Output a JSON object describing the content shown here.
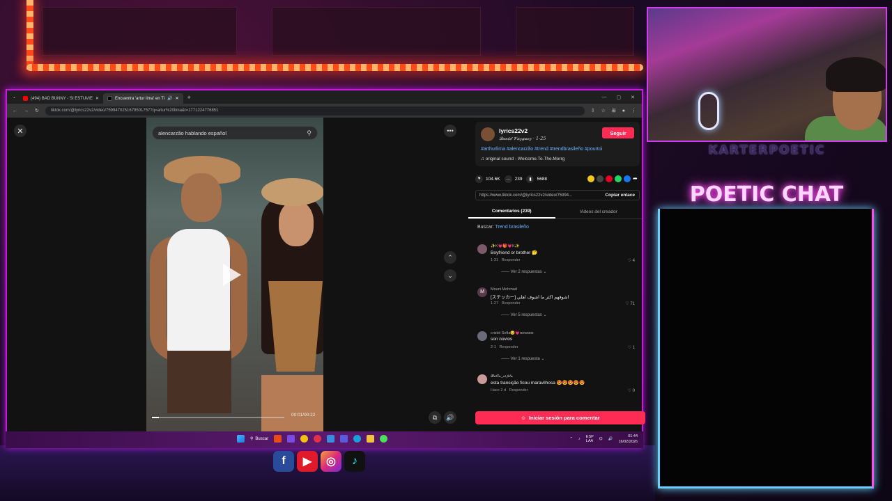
{
  "browser": {
    "tabs": [
      {
        "label": "(494) BAD BUNNY - SI ESTUVIE",
        "fav_color": "#ff0000"
      },
      {
        "label": "Encuentra 'artur lima' en Ti",
        "fav_color": "#000000"
      }
    ],
    "new_tab": "+",
    "url": "tiktok.com/@lyrics22v2/video/7599470251679501757?q=artur%20lima&t=1771224776851"
  },
  "video": {
    "search_text": "alencarzão hablando español",
    "time": "00:01/00:22",
    "progress": 0.05
  },
  "post": {
    "username": "lyrics22v2",
    "display_name": "𝓓𝓪𝓿𝓲𝓭 𝓥𝓪𝔃𝓺𝓾𝓮𝔃",
    "date": "· 1-25",
    "follow": "Seguir",
    "hashtags": "#arthurlima #alencarzão #trend #trendbrasileño #pourtoi",
    "sound": "♫  original sound - Welcome.To.The.Morrg",
    "likes": "104.6K",
    "comments": "239",
    "saves": "5688",
    "link": "https://www.tiktok.com/@lyrics22v2/video/75994...",
    "copy_link": "Copiar enlace",
    "tab_comments": "Comentarios (239)",
    "tab_videos": "Videos del creador",
    "search_prefix": "Buscar:",
    "search_term": "Trend brasileño",
    "login": "Iniciar sesión para comentar"
  },
  "comments": [
    {
      "user": "✨K💗🎁💗K✨",
      "text": "Boyfriend or brother 🤔",
      "date": "1-31",
      "reply": "Responder",
      "likes": "4",
      "replies": "Ver 2 respuestas ⌄"
    },
    {
      "user": "Mouni Mohmad",
      "text": "[ステッカー] اشوفهم اكثر ما اشوف اهلي",
      "date": "1-27",
      "reply": "Responder",
      "likes": "71",
      "replies": "Ver 5 respuestas ⌄"
    },
    {
      "user": "cristel Sofia😊💗ɴᴏᴡᴍᴏᴇ",
      "text": "son novios",
      "date": "2-1",
      "reply": "Responder",
      "likes": "1",
      "replies": "Ver 1 respuesta ⌄"
    },
    {
      "user": "𝓑𝓮𝓵𝓵𝓪_𝓼𝓮𝓹𝓽𝓪",
      "text": "esta transição ficou maravilhosa 😍😍😍😍😍",
      "date": "Hace 2 d",
      "reply": "Responder",
      "likes": "0",
      "replies": ""
    }
  ],
  "taskbar": {
    "search": "Buscar",
    "lang": "ESP\nLAA",
    "time": "01:44",
    "date": "16/02/2026"
  },
  "overlay": {
    "streamer": "KARTERPOETIC",
    "chat_title": "POETIC CHAT"
  }
}
